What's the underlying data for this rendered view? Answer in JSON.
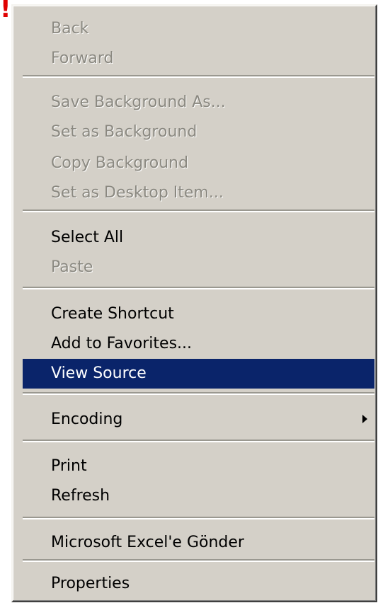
{
  "indicator": "!",
  "menu": {
    "items": [
      {
        "label": "Back",
        "state": "disabled"
      },
      {
        "label": "Forward",
        "state": "disabled"
      },
      {
        "label": "Save Background As...",
        "state": "disabled"
      },
      {
        "label": "Set as Background",
        "state": "disabled"
      },
      {
        "label": "Copy Background",
        "state": "disabled"
      },
      {
        "label": "Set as Desktop Item...",
        "state": "disabled"
      },
      {
        "label": "Select All",
        "state": "enabled"
      },
      {
        "label": "Paste",
        "state": "disabled"
      },
      {
        "label": "Create Shortcut",
        "state": "enabled"
      },
      {
        "label": "Add to Favorites...",
        "state": "enabled"
      },
      {
        "label": "View Source",
        "state": "selected"
      },
      {
        "label": "Encoding",
        "state": "enabled",
        "submenu_icon": "chevron-right-icon"
      },
      {
        "label": "Print",
        "state": "enabled"
      },
      {
        "label": "Refresh",
        "state": "enabled"
      },
      {
        "label": "Microsoft Excel'e Gönder",
        "state": "enabled"
      },
      {
        "label": "Properties",
        "state": "enabled"
      }
    ]
  },
  "colors": {
    "menu_background": "#d4d0c8",
    "selection_background": "#0a246a",
    "selection_text": "#ffffff",
    "disabled_text": "#8a8880",
    "indicator": "#e00000"
  }
}
